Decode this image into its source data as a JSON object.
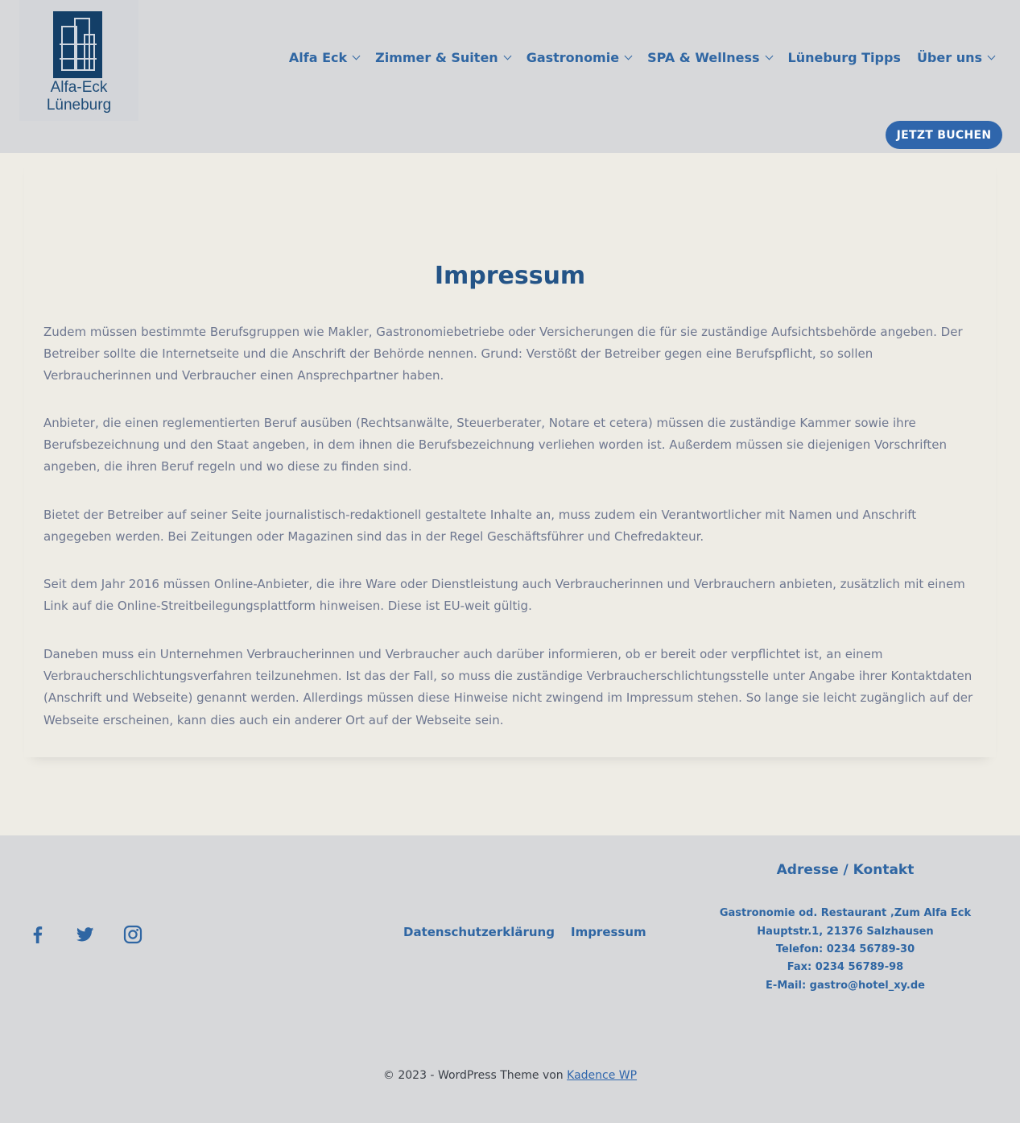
{
  "brand": {
    "line1": "Alfa-Eck",
    "line2": "Lüneburg"
  },
  "nav": {
    "items": [
      {
        "label": "Alfa Eck",
        "has_dropdown": true
      },
      {
        "label": "Zimmer & Suiten",
        "has_dropdown": true
      },
      {
        "label": "Gastronomie",
        "has_dropdown": true
      },
      {
        "label": "SPA & Wellness",
        "has_dropdown": true
      },
      {
        "label": "Lüneburg Tipps",
        "has_dropdown": false
      },
      {
        "label": "Über uns",
        "has_dropdown": true
      }
    ],
    "cta_label": "JETZT BUCHEN"
  },
  "main": {
    "title": "Impressum",
    "paragraphs": [
      "Zudem müssen bestimmte Berufsgruppen wie Makler, Gastronomiebetriebe oder Versicherungen die für sie zuständige Aufsichtsbehörde angeben. Der Betreiber sollte die Internetseite und die Anschrift der Behörde nennen. Grund: Verstößt der Betreiber gegen eine Berufspflicht, so sollen Verbraucherinnen und Verbraucher einen Ansprechpartner haben.",
      "Anbieter, die einen reglementierten Beruf ausüben (Rechtsanwälte, Steuerberater, Notare et cetera) müssen die zuständige Kammer sowie ihre Berufsbezeichnung und den Staat angeben, in dem ihnen die Berufsbezeichnung verliehen worden ist. Außerdem müssen sie diejenigen Vorschriften angeben, die ihren Beruf regeln und wo diese zu finden sind.",
      "Bietet der Betreiber auf seiner Seite journalistisch-redaktionell gestaltete Inhalte an, muss zudem ein Verantwortlicher mit Namen und Anschrift angegeben werden. Bei Zeitungen oder Magazinen sind das in der Regel Geschäftsführer und Chefredakteur.",
      "Seit dem Jahr 2016 müssen Online-Anbieter, die ihre Ware oder Dienstleistung auch Verbraucherinnen und Verbrauchern anbieten, zusätzlich mit einem Link auf die Online-Streitbeilegungsplattform hinweisen. Diese ist EU-weit gültig.",
      "Daneben muss ein Unternehmen Verbraucherinnen und Verbraucher auch darüber informieren, ob er bereit oder verpflichtet ist, an einem Verbraucherschlichtungsverfahren teilzunehmen. Ist das der Fall, so muss die zuständige Verbraucherschlichtungsstelle unter Angabe ihrer Kontaktdaten (Anschrift und Webseite) genannt werden. Allerdings müssen diese Hinweise nicht zwingend im Impressum stehen. So lange sie leicht zugänglich auf der Webseite erscheinen, kann dies auch ein anderer Ort auf der Webseite sein."
    ]
  },
  "footer": {
    "social": [
      "facebook-icon",
      "twitter-icon",
      "instagram-icon"
    ],
    "links": [
      "Datenschutzerklärung",
      "Impressum"
    ],
    "contact": {
      "heading": "Adresse / Kontakt",
      "lines": [
        "Gastronomie od. Restaurant ‚Zum Alfa Eck",
        "Hauptstr.1, 21376 Salzhausen",
        "Telefon: 0234 56789-30",
        "Fax: 0234 56789-98",
        "E-Mail: gastro@hotel_xy.de"
      ]
    },
    "copyright_text": "© 2023 - WordPress Theme von ",
    "copyright_link": "Kadence WP"
  },
  "colors": {
    "header_bg": "#d7d8da",
    "page_bg": "#eeece5",
    "accent": "#2f66ac",
    "title": "#245487",
    "body_text": "#6e7790"
  }
}
